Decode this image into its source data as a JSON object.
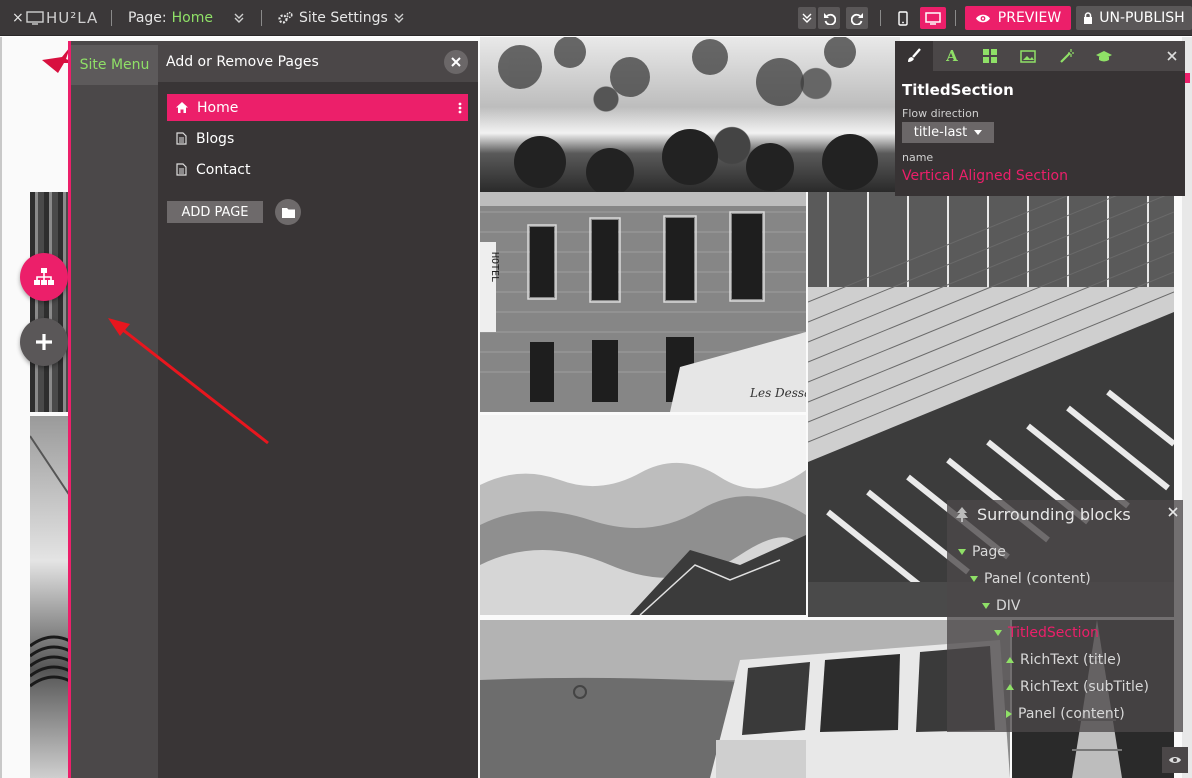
{
  "brand": "HU²LA",
  "topbar": {
    "page_label": "Page:",
    "page_name": "Home",
    "site_settings": "Site Settings",
    "preview": "PREVIEW",
    "unpublish": "UN-PUBLISH"
  },
  "colors": {
    "accent": "#ec1f6a",
    "green": "#8fe067",
    "panel": "#393536"
  },
  "site_menu": {
    "label": "Site Menu"
  },
  "pages_panel": {
    "title": "Add or Remove Pages",
    "pages": [
      {
        "label": "Home",
        "icon": "home-icon",
        "active": true
      },
      {
        "label": "Blogs",
        "icon": "file-icon",
        "active": false
      },
      {
        "label": "Contact",
        "icon": "file-icon",
        "active": false
      }
    ],
    "add_page": "ADD PAGE"
  },
  "props": {
    "title": "TitledSection",
    "flow_label": "Flow direction",
    "flow_value": "title-last",
    "name_label": "name",
    "name_value": "Vertical Aligned Section"
  },
  "surrounding": {
    "title": "Surrounding blocks",
    "items": [
      {
        "label": "Page"
      },
      {
        "label": "Panel (content)"
      },
      {
        "label": "DIV"
      },
      {
        "label": "TitledSection"
      },
      {
        "label": "RichText (title)"
      },
      {
        "label": "RichText (subTitle)"
      },
      {
        "label": "Panel (content)"
      }
    ]
  },
  "images": {
    "hotel_sign": "HOTEL",
    "shop_sign": "Les Dessa"
  }
}
